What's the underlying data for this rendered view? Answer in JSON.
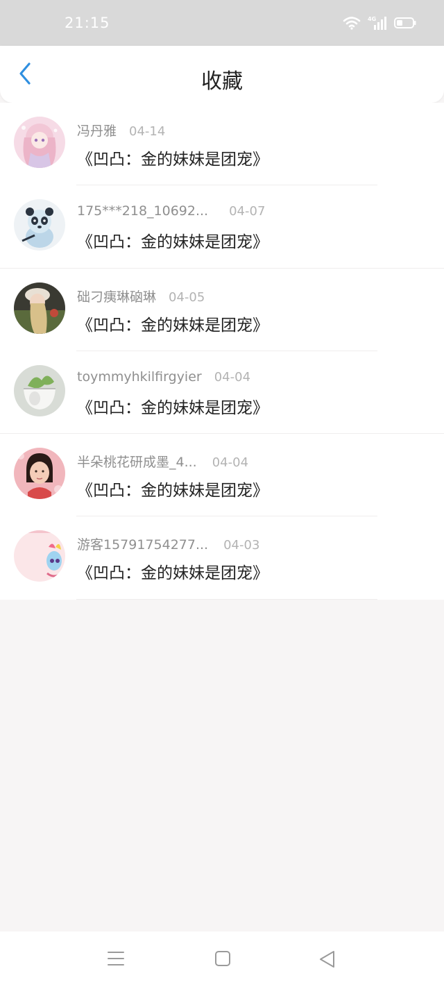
{
  "status_bar": {
    "time": "21:15",
    "icons": [
      "wifi-icon",
      "4g-signal-icon",
      "battery-icon"
    ],
    "network_label": "4G"
  },
  "header": {
    "title": "收藏",
    "back_icon": "chevron-left-icon",
    "accent_color": "#2f8fe0"
  },
  "favorites": [
    {
      "user": "冯丹雅",
      "date": "04-14",
      "title": "《凹凸：金的妹妹是团宠》",
      "avatar": "anime-girl-avatar"
    },
    {
      "user": "175***218_10692...",
      "date": "04-07",
      "title": "《凹凸：金的妹妹是团宠》",
      "avatar": "panda-avatar"
    },
    {
      "user": "础刁痍琳硇琳",
      "date": "04-05",
      "title": "《凹凸：金的妹妹是团宠》",
      "avatar": "girl-hat-avatar"
    },
    {
      "user": "toymmyhkilfirgyier",
      "date": "04-04",
      "title": "《凹凸：金的妹妹是团宠》",
      "avatar": "plant-pot-avatar"
    },
    {
      "user": "半朵桃花研成墨_4...",
      "date": "04-04",
      "title": "《凹凸：金的妹妹是团宠》",
      "avatar": "child-photo-avatar"
    },
    {
      "user": "游客15791754277...",
      "date": "04-03",
      "title": "《凹凸：金的妹妹是团宠》",
      "avatar": "pony-avatar"
    }
  ],
  "nav_bar": {
    "icons": [
      "menu-icon",
      "home-square-icon",
      "back-triangle-icon"
    ]
  },
  "colors": {
    "background": "#f7f5f5",
    "status_bar": "#d9d9d9",
    "username": "#8f8f8f",
    "date": "#b3b3b3",
    "title": "#222222"
  }
}
